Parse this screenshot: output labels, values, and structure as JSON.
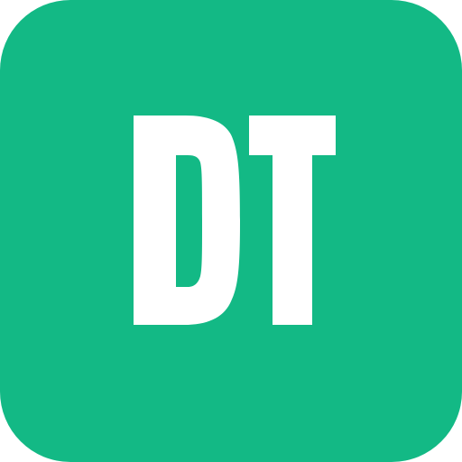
{
  "app_icon": {
    "monogram": "DT",
    "background_color": "#13B985",
    "foreground_color": "#FFFFFF"
  }
}
